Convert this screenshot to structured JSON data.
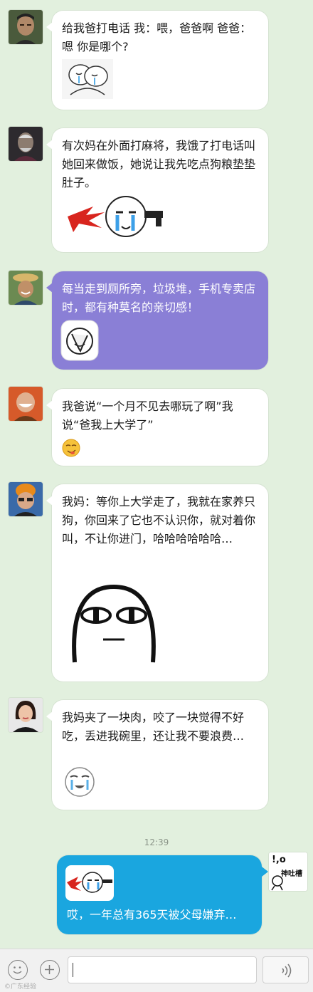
{
  "messages": [
    {
      "text": "给我爸打电话 我：喂，爸爸啊 爸爸：嗯 你是哪个?",
      "avatar": "man-short-hair-avatar",
      "sticker": "crying-hug-sticker"
    },
    {
      "text": "有次妈在外面打麻将，我饿了打电话叫她回来做饭，她说让我先吃点狗粮垫垫肚子。",
      "avatar": "old-man-avatar",
      "sticker": "crying-gun-sticker"
    },
    {
      "text": "每当走到厕所旁，垃圾堆，手机专卖店时，都有种莫名的亲切感！",
      "avatar": "straw-hat-man-avatar",
      "sticker": "facepalm-sticker",
      "bubble_color": "#8a7fd6"
    },
    {
      "text": "我爸说“一个月不见去哪玩了啊”我说“爸我上大学了”",
      "avatar": "bald-man-laughing-avatar",
      "sticker": "smirk-emoji"
    },
    {
      "text": "我妈：等你上大学走了，我就在家养只狗，你回来了它也不认识你，就对着你叫，不让你进门，哈哈哈哈哈哈…",
      "avatar": "orange-helmet-man-avatar",
      "sticker": "deadpan-face-sticker"
    },
    {
      "text": "我妈夹了一块肉，咬了一块觉得不好吃，丢进我碗里，还让我不要浪费…",
      "avatar": "woman-avatar",
      "sticker": "tearful-smile-sticker"
    }
  ],
  "timestamp": "12:39",
  "my_message": {
    "text": "哎，一年总有365天被父母嫌弃…",
    "sticker": "crying-gun-sticker",
    "bubble_color": "#1aa6df",
    "avatar_text": "神吐槽"
  },
  "input_bar": {
    "input_value": "",
    "emoji_icon": "smiley-icon",
    "plus_icon": "plus-icon",
    "voice_icon": "voice-icon"
  },
  "watermark": "©广东经验"
}
